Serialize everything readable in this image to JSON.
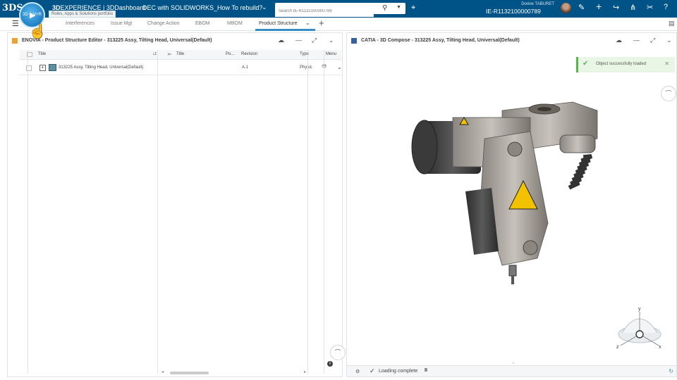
{
  "topbar": {
    "logo": "3DS",
    "compass_3d": "3D",
    "compass_v": "V+R",
    "tooltip": "Roles, Apps & Solutions portfolio",
    "brand_prefix": "3D",
    "brand_rest": "EXPERIENCE | 3DDashboard",
    "dashboard_name": "DEC with SOLIDWORKS_How To rebuild?",
    "search": {
      "placeholder": "Search IE-R1132100000789",
      "value": ""
    },
    "user_name": "Dorine TABURET",
    "user_id": "IE-R1132100000789",
    "icons": [
      "tag-icon",
      "share-icon",
      "plus-icon",
      "forward-icon",
      "network-icon",
      "tools-icon",
      "help-icon"
    ]
  },
  "tabs": [
    {
      "label": "Interferences"
    },
    {
      "label": "Issue Mgt"
    },
    {
      "label": "Change Action"
    },
    {
      "label": "EBOM"
    },
    {
      "label": "MBOM"
    },
    {
      "label": "Product Structure"
    }
  ],
  "left_panel": {
    "title": "ENOVIA - Product Structure Editor - 313225 Assy, Tilting Head, Universal(Default)",
    "columns": [
      "Title",
      "Title",
      "Po...",
      "Revision",
      "Type",
      "Menu"
    ],
    "sort_icon": "↓z",
    "rows": [
      {
        "title": "313225 Assy, Tilting Head, Universal(Default)",
        "revision": "A.1",
        "type": "Physic",
        "expand": "+"
      }
    ],
    "info": "i"
  },
  "right_panel": {
    "title": "CATIA - 3D Compose - 313225 Assy, Tilting Head, Universal(Default)",
    "toast": "Object successfully loaded",
    "status": "Loading complete",
    "pause": "II",
    "axes": {
      "x": "x",
      "y": "y",
      "z": "z"
    }
  },
  "colors": {
    "topbar": "#005386",
    "accent": "#368ec4",
    "success": "#57b847"
  }
}
